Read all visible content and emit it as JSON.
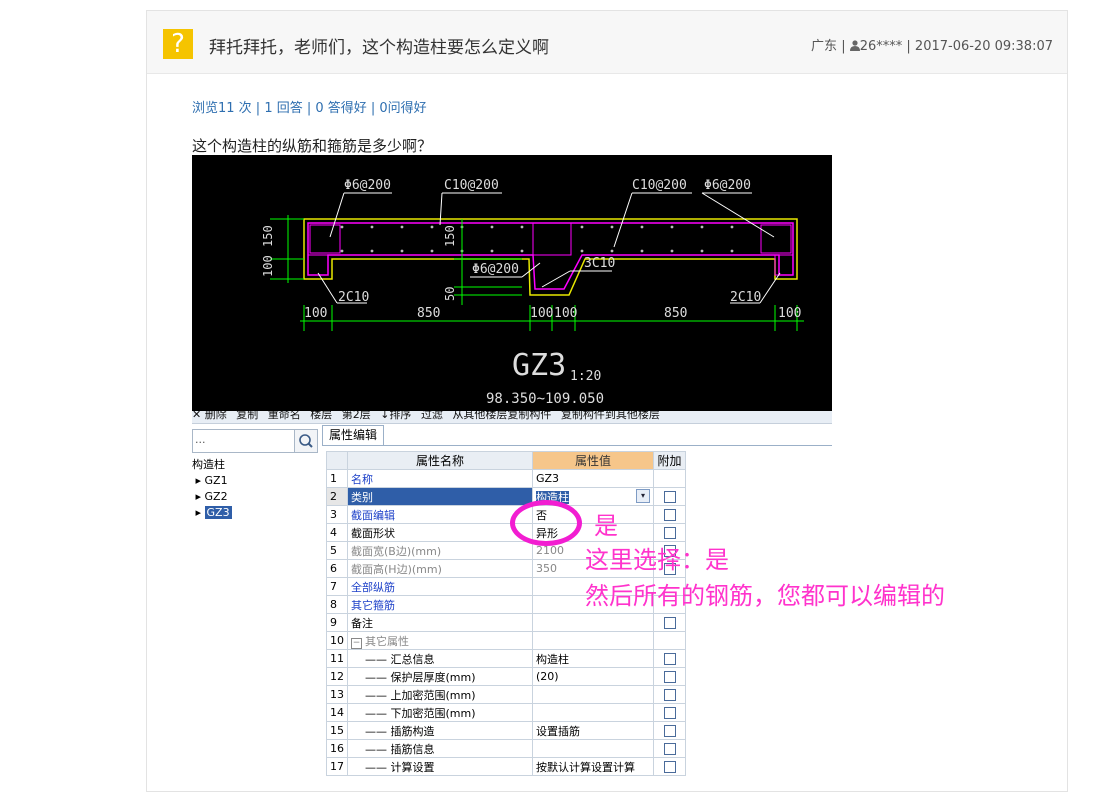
{
  "question": {
    "icon": "question-mark-icon",
    "title": "拜托拜托，老师们，这个构造柱要怎么定义啊",
    "meta": {
      "region": "广东",
      "user": "26****",
      "datetime": "2017-06-20 09:38:07"
    },
    "stats": "浏览11 次 | 1 回答 | 0 答得好 | 0问得好",
    "body": "这个构造柱的纵筋和箍筋是多少啊？"
  },
  "drawing": {
    "labels": [
      "Φ6@200",
      "C10@200",
      "C10@200",
      "Φ6@200",
      "Φ6@200",
      "3C10",
      "2C10",
      "2C10",
      "150",
      "100",
      "150",
      "50",
      "100",
      "850",
      "100",
      "100",
      "850",
      "100"
    ],
    "title": "GZ3",
    "scale": "1:20",
    "range": "98.350~109.050"
  },
  "software": {
    "toolbar": [
      "✕ 删除",
      "复制",
      "重命名",
      "楼层",
      "第2层",
      "↓排序",
      "过滤",
      "从其他楼层复制构件",
      "复制构件到其他楼层"
    ],
    "search_placeholder": "...",
    "tree": {
      "root": "构造柱",
      "items": [
        "GZ1",
        "GZ2",
        "GZ3"
      ]
    },
    "tab": "属性编辑",
    "table": {
      "headers": [
        "属性名称",
        "属性值",
        "附加"
      ],
      "rows": [
        {
          "n": "1",
          "name": "名称",
          "value": "GZ3"
        },
        {
          "n": "2",
          "name": "类别",
          "value": "构造柱"
        },
        {
          "n": "3",
          "name": "截面编辑",
          "value": "否"
        },
        {
          "n": "4",
          "name": "截面形状",
          "value": "异形"
        },
        {
          "n": "5",
          "name": "截面宽(B边)(mm)",
          "value": "2100"
        },
        {
          "n": "6",
          "name": "截面高(H边)(mm)",
          "value": "350"
        },
        {
          "n": "7",
          "name": "全部纵筋",
          "value": ""
        },
        {
          "n": "8",
          "name": "其它箍筋",
          "value": ""
        },
        {
          "n": "9",
          "name": "备注",
          "value": ""
        },
        {
          "n": "10",
          "name": "其它属性",
          "value": ""
        },
        {
          "n": "11",
          "name": "汇总信息",
          "value": "构造柱"
        },
        {
          "n": "12",
          "name": "保护层厚度(mm)",
          "value": "(20)"
        },
        {
          "n": "13",
          "name": "上加密范围(mm)",
          "value": ""
        },
        {
          "n": "14",
          "name": "下加密范围(mm)",
          "value": ""
        },
        {
          "n": "15",
          "name": "插筋构造",
          "value": "设置插筋"
        },
        {
          "n": "16",
          "name": "插筋信息",
          "value": ""
        },
        {
          "n": "17",
          "name": "计算设置",
          "value": "按默认计算设置计算"
        }
      ]
    }
  },
  "annotation": {
    "mark": "是",
    "line1": "这里选择：是",
    "line2": "然后所有的钢筋，您都可以编辑的"
  },
  "colors": {
    "annotation": "#ff33cc",
    "link": "#2f6fb0",
    "cad_yellow": "#e8e800",
    "cad_magenta": "#ff00ff",
    "cad_green": "#00ff00"
  }
}
